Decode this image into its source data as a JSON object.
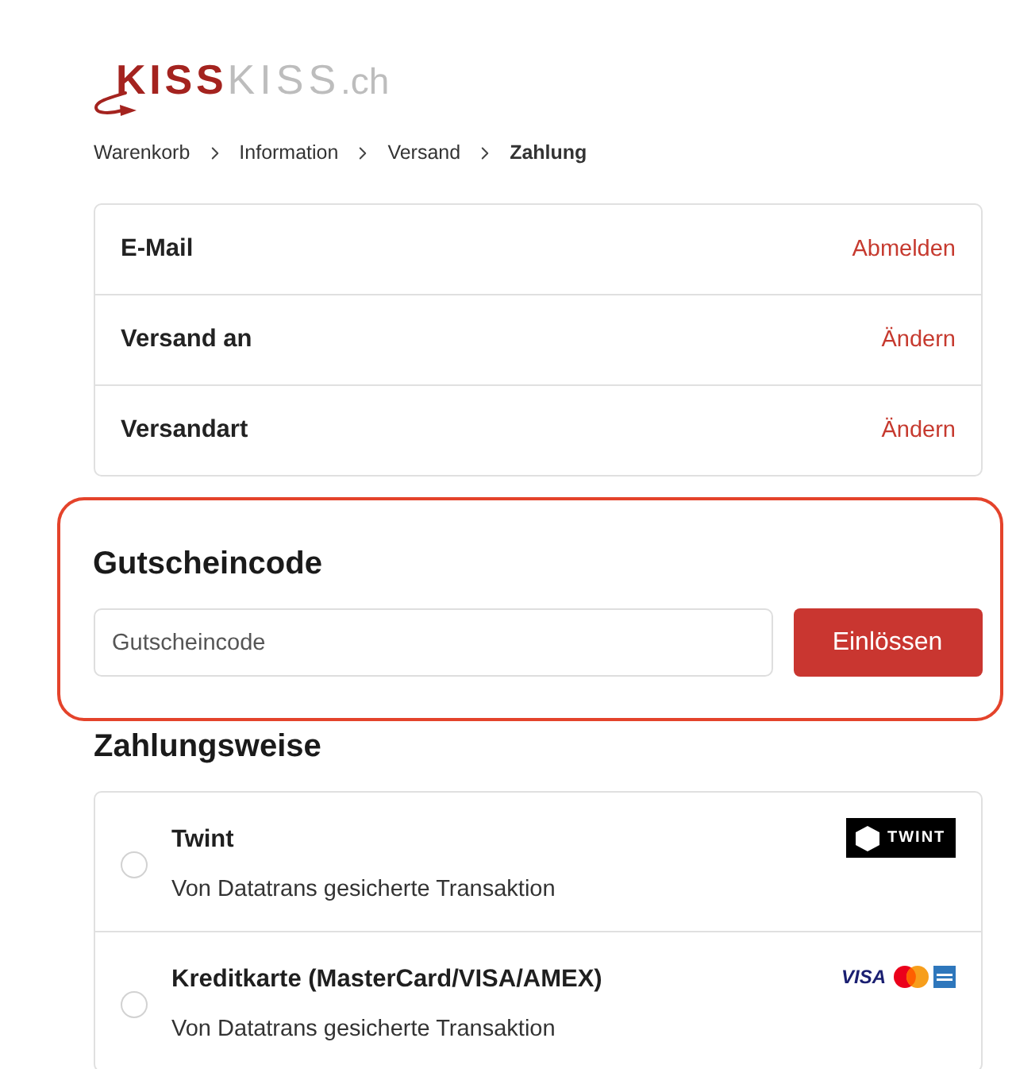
{
  "logo": {
    "primary": "KISS",
    "secondary": "KISS",
    "suffix": ".ch"
  },
  "breadcrumb": [
    {
      "label": "Warenkorb",
      "current": false
    },
    {
      "label": "Information",
      "current": false
    },
    {
      "label": "Versand",
      "current": false
    },
    {
      "label": "Zahlung",
      "current": true
    }
  ],
  "summary": [
    {
      "label": "E-Mail",
      "action": "Abmelden"
    },
    {
      "label": "Versand an",
      "action": "Ändern"
    },
    {
      "label": "Versandart",
      "action": "Ändern"
    }
  ],
  "coupon": {
    "title": "Gutscheincode",
    "placeholder": "Gutscheincode",
    "button": "Einlössen",
    "highlighted": true
  },
  "payment": {
    "title": "Zahlungsweise",
    "methods": [
      {
        "name": "Twint",
        "note": "Von Datatrans gesicherte Transaktion",
        "selected": false,
        "logos": [
          {
            "kind": "twint",
            "text": "TWINT"
          }
        ]
      },
      {
        "name": "Kreditkarte (MasterCard/VISA/AMEX)",
        "note": "Von Datatrans gesicherte Transaktion",
        "selected": false,
        "logos": [
          {
            "kind": "visa",
            "text": "VISA"
          },
          {
            "kind": "mastercard"
          },
          {
            "kind": "amex"
          }
        ]
      }
    ]
  }
}
